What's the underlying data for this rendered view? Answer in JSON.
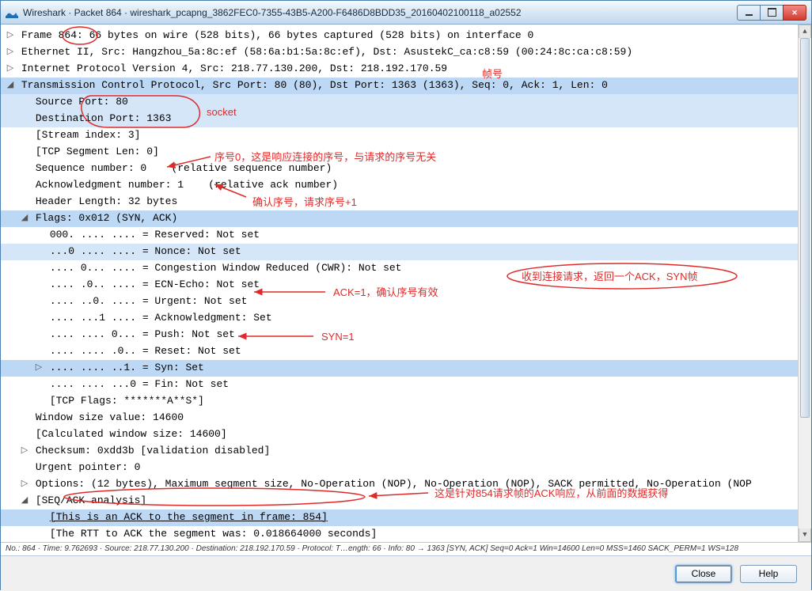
{
  "window": {
    "title": "Wireshark · Packet 864 · wireshark_pcapng_3862FEC0-7355-43B5-A200-F6486D8BDD35_20160402100118_a02552"
  },
  "tree": {
    "frame": "Frame 864: 66 bytes on wire (528 bits), 66 bytes captured (528 bits) on interface 0",
    "eth": "Ethernet II, Src: Hangzhou_5a:8c:ef (58:6a:b1:5a:8c:ef), Dst: AsustekC_ca:c8:59 (00:24:8c:ca:c8:59)",
    "ip": "Internet Protocol Version 4, Src: 218.77.130.200, Dst: 218.192.170.59",
    "tcp": "Transmission Control Protocol, Src Port: 80 (80), Dst Port: 1363 (1363), Seq: 0, Ack: 1, Len: 0",
    "srcport": "Source Port: 80",
    "dstport": "Destination Port: 1363",
    "stream": "[Stream index: 3]",
    "seglen": "[TCP Segment Len: 0]",
    "seq": "Sequence number: 0    (relative sequence number)",
    "ack": "Acknowledgment number: 1    (relative ack number)",
    "hdrlen": "Header Length: 32 bytes",
    "flags": "Flags: 0x012 (SYN, ACK)",
    "f_res": "000. .... .... = Reserved: Not set",
    "f_nonce": "...0 .... .... = Nonce: Not set",
    "f_cwr": ".... 0... .... = Congestion Window Reduced (CWR): Not set",
    "f_ecn": ".... .0.. .... = ECN-Echo: Not set",
    "f_urg": ".... ..0. .... = Urgent: Not set",
    "f_ackf": ".... ...1 .... = Acknowledgment: Set",
    "f_psh": ".... .... 0... = Push: Not set",
    "f_rst": ".... .... .0.. = Reset: Not set",
    "f_syn": ".... .... ..1. = Syn: Set",
    "f_fin": ".... .... ...0 = Fin: Not set",
    "f_str": "[TCP Flags: *******A**S*]",
    "wnd": "Window size value: 14600",
    "cwnd": "[Calculated window size: 14600]",
    "cksum": "Checksum: 0xdd3b [validation disabled]",
    "urgp": "Urgent pointer: 0",
    "opts": "Options: (12 bytes), Maximum segment size, No-Operation (NOP), No-Operation (NOP), SACK permitted, No-Operation (NOP",
    "seqack": "[SEQ/ACK analysis]",
    "ackto": "[This is an ACK to the segment in frame: 854]",
    "rtt": "[The RTT to ACK the segment was: 0.018664000 seconds]"
  },
  "status": "No.: 864 · Time: 9.762693 · Source: 218.77.130.200 · Destination: 218.192.170.59 · Protocol: T…ength: 66 · Info: 80 → 1363 [SYN, ACK] Seq=0 Ack=1 Win=14600 Len=0 MSS=1460 SACK_PERM=1 WS=128",
  "buttons": {
    "close": "Close",
    "help": "Help"
  },
  "annotations": {
    "frame_no": "帧号",
    "socket": "socket",
    "seq0": "序号0，这是响应连接的序号，与请求的序号无关",
    "ackno": "确认序号，请求序号+1",
    "ack1": "ACK=1，确认序号有效",
    "syn1": "SYN=1",
    "recv": "收到连接请求，返回一个ACK，SYN帧",
    "ack854": "这是针对854请求帧的ACK响应，从前面的数据获得"
  }
}
